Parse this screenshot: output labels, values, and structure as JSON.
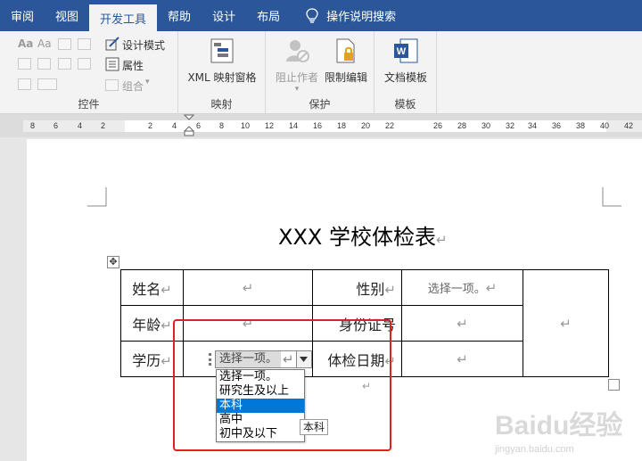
{
  "tabs": [
    {
      "label": "审阅",
      "active": false
    },
    {
      "label": "视图",
      "active": false
    },
    {
      "label": "开发工具",
      "active": true
    },
    {
      "label": "帮助",
      "active": false
    },
    {
      "label": "设计",
      "active": false
    },
    {
      "label": "布局",
      "active": false
    }
  ],
  "search_tab": {
    "label": "操作说明搜索",
    "icon": "lightbulb-icon"
  },
  "ribbon": {
    "controls": {
      "label": "控件",
      "design_mode": "设计模式",
      "properties": "属性",
      "group": "组合"
    },
    "mapping": {
      "label": "映射",
      "xml_pane": "XML 映射窗格"
    },
    "protect": {
      "label": "保护",
      "block_authors": "阻止作者",
      "restrict_editing": "限制编辑"
    },
    "templates": {
      "label": "模板",
      "document_template": "文档模板"
    }
  },
  "ruler_numbers": [
    "8",
    "6",
    "4",
    "2",
    "2",
    "4",
    "6",
    "8",
    "10",
    "12",
    "14",
    "16",
    "18",
    "20",
    "22",
    "26",
    "28",
    "30",
    "32",
    "34",
    "36",
    "38",
    "40",
    "42"
  ],
  "document": {
    "title": "XXX 学校体检表",
    "table": {
      "row1": {
        "label1": "姓名",
        "label2": "性别",
        "dropdown_placeholder": "选择一项。"
      },
      "row2": {
        "label1": "年龄",
        "label2": "身份证号"
      },
      "row3": {
        "label1": "学历",
        "label2": "体检日期"
      }
    },
    "paragraph_mark": "↵"
  },
  "content_control": {
    "current_value": "选择一项。",
    "options": [
      "选择一项。",
      "研究生及以上",
      "本科",
      "高中",
      "初中及以下"
    ],
    "highlighted_index": 2,
    "tooltip": "本科"
  },
  "colors": {
    "tab_bar": "#2b579a",
    "selection": "#0078d7",
    "highlight_box": "#e02020"
  },
  "watermark": {
    "text": "Baidu经验",
    "url": "jingyan.baidu.com"
  }
}
